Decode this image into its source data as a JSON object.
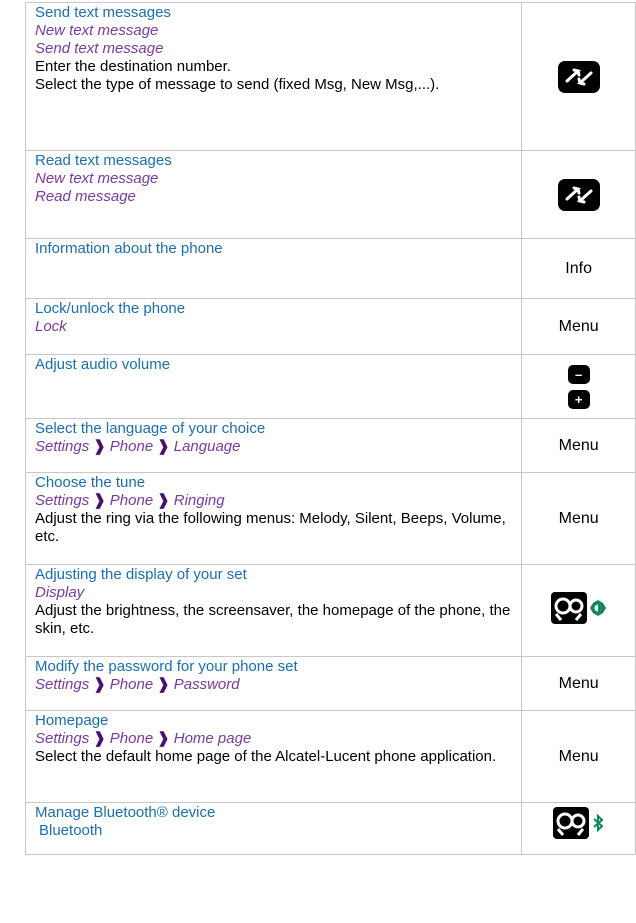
{
  "rows": [
    {
      "title": "Send text messages",
      "paths": [
        "New text message",
        "Send text message"
      ],
      "desc": [
        "Enter the destination number.",
        "Select the type of message to send (fixed Msg, New Msg,...)."
      ],
      "icon": "message-key-icon"
    },
    {
      "title": "Read text messages",
      "paths": [
        "New text message",
        "Read message"
      ],
      "icon": "message-key-icon"
    },
    {
      "title": "Information about the phone",
      "label": "Info"
    },
    {
      "title": "Lock/unlock the phone",
      "paths": [
        "Lock"
      ],
      "label": "Menu"
    },
    {
      "title": "Adjust audio volume",
      "icons": [
        "minus-key-icon",
        "plus-key-icon"
      ],
      "minus_symbol": "–",
      "plus_symbol": "+"
    },
    {
      "title": "Select the language of your choice",
      "breadcrumb": [
        "Settings",
        "Phone",
        "Language"
      ],
      "label": "Menu"
    },
    {
      "title": "Choose the tune",
      "breadcrumb": [
        "Settings",
        "Phone",
        "Ringing"
      ],
      "desc": [
        "Adjust the ring via the following menus: Melody, Silent, Beeps, Volume, etc."
      ],
      "label": "Menu"
    },
    {
      "title": "Adjusting the display of your set",
      "paths": [
        "Display"
      ],
      "desc": [
        "Adjust the brightness, the screensaver, the homepage of the phone, the skin, etc."
      ],
      "icons": [
        "settings-gears-icon",
        "brightness-icon"
      ]
    },
    {
      "title": "Modify the password for your phone set",
      "breadcrumb": [
        "Settings",
        "Phone",
        "Password"
      ],
      "label": "Menu"
    },
    {
      "title": "Homepage",
      "breadcrumb": [
        "Settings",
        "Phone",
        "Home page"
      ],
      "desc": [
        "Select the default home page of the Alcatel-Lucent phone application."
      ],
      "label": "Menu"
    },
    {
      "title": "Manage Bluetooth® device",
      "desc": [
        "Bluetooth"
      ],
      "icons": [
        "settings-gears-icon",
        "bluetooth-icon"
      ]
    }
  ],
  "breadcrumb_separator": "❱",
  "colors": {
    "title": "#1a6fb0",
    "path": "#7a3aa0",
    "icon_bg": "#000000",
    "accent_green": "#0d8a5a"
  }
}
